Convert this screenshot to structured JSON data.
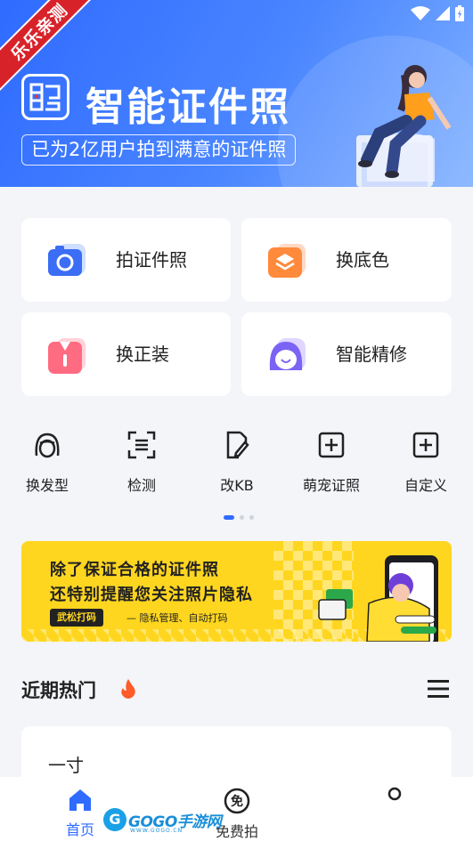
{
  "header": {
    "ribbon_text": "乐乐亲测",
    "title": "智能证件照",
    "slogan": "已为2亿用户拍到满意的证件照"
  },
  "feature_cards": [
    {
      "label": "拍证件照",
      "icon": "camera-icon"
    },
    {
      "label": "换底色",
      "icon": "layers-icon"
    },
    {
      "label": "换正装",
      "icon": "suit-icon"
    },
    {
      "label": "智能精修",
      "icon": "beauty-face-icon"
    }
  ],
  "tools": [
    {
      "label": "换发型",
      "icon": "hairstyle-icon"
    },
    {
      "label": "检测",
      "icon": "scan-icon"
    },
    {
      "label": "改KB",
      "icon": "edit-file-icon"
    },
    {
      "label": "萌宠证照",
      "icon": "plus-square-icon"
    },
    {
      "label": "自定义",
      "icon": "plus-square-icon"
    }
  ],
  "carousel": {
    "pages": 3,
    "active": 0
  },
  "promo": {
    "line1": "除了保证合格的证件照",
    "line2": "还特别提醒您关注照片隐私",
    "tag": "武松打码",
    "sub": "— 隐私管理、自动打码"
  },
  "hot": {
    "title": "近期热门",
    "items": [
      "一寸"
    ]
  },
  "bottom_nav": {
    "items": [
      {
        "label": "首页",
        "icon": "home-icon",
        "active": true
      },
      {
        "label": "免费拍",
        "icon": "free-badge-icon",
        "active": false
      },
      {
        "label": "",
        "icon": "profile-dot-icon",
        "active": false
      }
    ]
  },
  "watermark": {
    "text": "GOGO手游网",
    "url": "WWW.GOGO.CN"
  },
  "colors": {
    "primary": "#2f6bff",
    "promo_bg": "#ffd61f",
    "ribbon": "#d8222a",
    "page_bg": "#f3f5f8"
  }
}
